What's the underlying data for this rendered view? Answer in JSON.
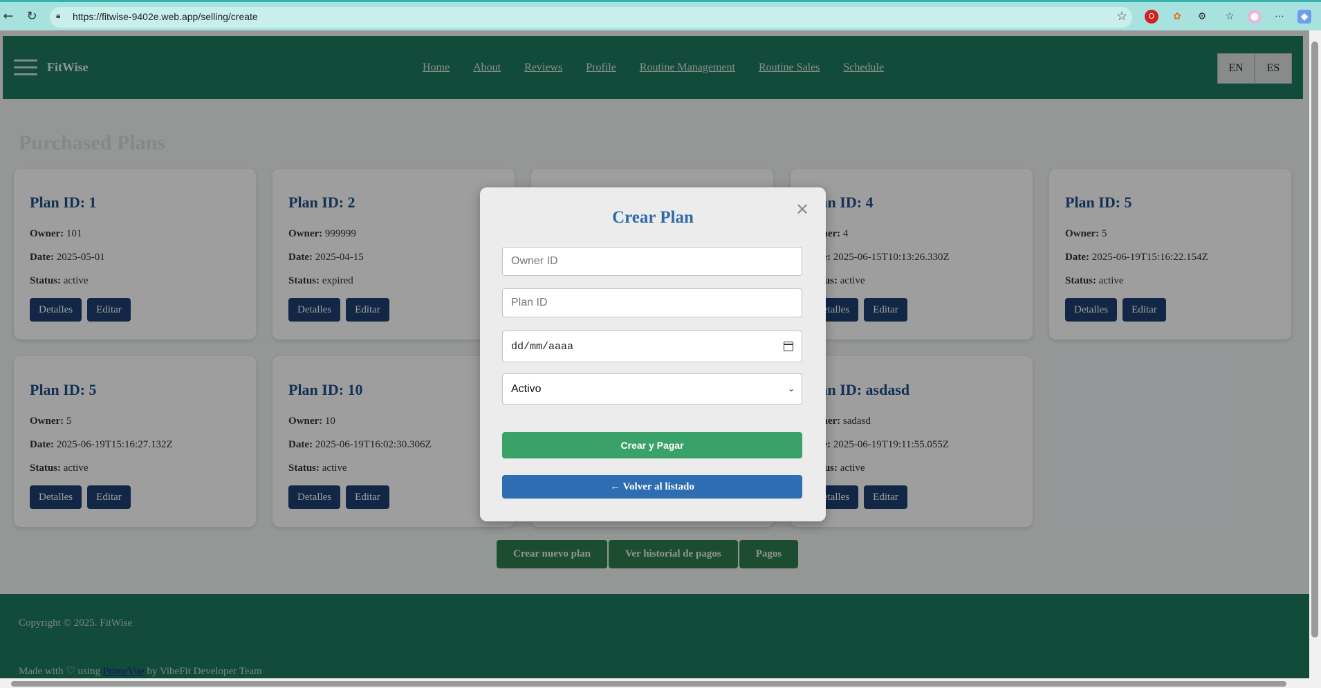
{
  "browser": {
    "url": "https://fitwise-9402e.web.app/selling/create"
  },
  "header": {
    "brand": "FitWise",
    "nav": [
      "Home",
      "About",
      "Reviews",
      "Profile",
      "Routine Management",
      "Routine Sales",
      "Schedule"
    ],
    "lang": [
      "EN",
      "ES"
    ]
  },
  "main": {
    "title": "Purchased Plans",
    "labels": {
      "owner": "Owner:",
      "date": "Date:",
      "status": "Status:"
    },
    "details_label": "Detalles",
    "edit_label": "Editar",
    "cards": [
      {
        "title": "Plan ID: 1",
        "owner": "101",
        "date": "2025-05-01",
        "status": "active"
      },
      {
        "title": "Plan ID: 2",
        "owner": "999999",
        "date": "2025-04-15",
        "status": "expired"
      },
      {
        "title": "Plan ID: 4",
        "owner": "4",
        "date": "2025-06-15T10:13:26.330Z",
        "status": "active"
      },
      {
        "title": "Plan ID: 5",
        "owner": "5",
        "date": "2025-06-19T15:16:22.154Z",
        "status": "active"
      },
      {
        "title": "Plan ID: 5",
        "owner": "5",
        "date": "2025-06-19T15:16:27.132Z",
        "status": "active"
      },
      {
        "title": "Plan ID: 10",
        "owner": "10",
        "date": "2025-06-19T16:02:30.306Z",
        "status": "active"
      },
      {
        "title": "Plan ID: asdasd",
        "owner": "sadasd",
        "date": "2025-06-19T19:11:55.055Z",
        "status": "active"
      }
    ],
    "actions": [
      "Crear nuevo plan",
      "Ver historial de pagos",
      "Pagos"
    ]
  },
  "footer": {
    "copyright": "Copyright © 2025. FitWise",
    "made_prefix": "Made with",
    "made_using": "using",
    "primevue": "PrimeVue",
    "made_suffix": "by VibeFit Developer Team"
  },
  "modal": {
    "title": "Crear Plan",
    "owner_placeholder": "Owner ID",
    "plan_placeholder": "Plan ID",
    "date_placeholder": "dd/mm/aaaa",
    "status_value": "Activo",
    "submit_label": "Crear y Pagar",
    "back_label": "← Volver al listado"
  }
}
